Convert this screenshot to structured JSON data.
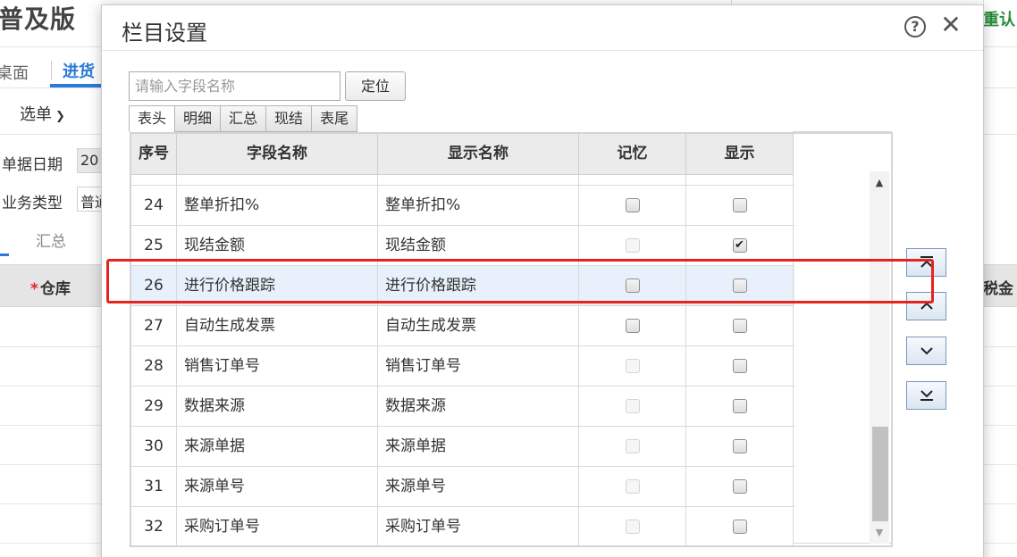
{
  "background": {
    "app_title": "普及版",
    "right_link": "重认",
    "tab_desktop": "桌面",
    "tab_purchase": "进货",
    "select_button": "选单",
    "date_label": "单据日期",
    "date_value": "20",
    "business_type_label": "业务类型",
    "business_type_value": "普通",
    "summary_tab": "汇总",
    "grid_col_warehouse": "仓库",
    "grid_col_required_mark": "*",
    "grid_col_tax": "税金"
  },
  "dialog": {
    "title": "栏目设置",
    "search_placeholder": "请输入字段名称",
    "locate_button": "定位",
    "tabs": [
      {
        "label": "表头",
        "active": true
      },
      {
        "label": "明细",
        "active": false
      },
      {
        "label": "汇总",
        "active": false
      },
      {
        "label": "现结",
        "active": false
      },
      {
        "label": "表尾",
        "active": false
      }
    ],
    "columns": [
      "序号",
      "字段名称",
      "显示名称",
      "记忆",
      "显示"
    ],
    "rows": [
      {
        "no": "24",
        "field": "整单折扣%",
        "display": "整单折扣%",
        "remember": false,
        "remember_enabled": true,
        "show": false,
        "selected": false
      },
      {
        "no": "25",
        "field": "现结金额",
        "display": "现结金额",
        "remember": false,
        "remember_enabled": false,
        "show": true,
        "selected": false
      },
      {
        "no": "26",
        "field": "进行价格跟踪",
        "display": "进行价格跟踪",
        "remember": false,
        "remember_enabled": true,
        "show": false,
        "selected": true
      },
      {
        "no": "27",
        "field": "自动生成发票",
        "display": "自动生成发票",
        "remember": false,
        "remember_enabled": true,
        "show": false,
        "selected": false
      },
      {
        "no": "28",
        "field": "销售订单号",
        "display": "销售订单号",
        "remember": false,
        "remember_enabled": false,
        "show": false,
        "selected": false
      },
      {
        "no": "29",
        "field": "数据来源",
        "display": "数据来源",
        "remember": false,
        "remember_enabled": false,
        "show": false,
        "selected": false
      },
      {
        "no": "30",
        "field": "来源单据",
        "display": "来源单据",
        "remember": false,
        "remember_enabled": false,
        "show": false,
        "selected": false
      },
      {
        "no": "31",
        "field": "来源单号",
        "display": "来源单号",
        "remember": false,
        "remember_enabled": false,
        "show": false,
        "selected": false
      },
      {
        "no": "32",
        "field": "采购订单号",
        "display": "采购订单号",
        "remember": false,
        "remember_enabled": false,
        "show": false,
        "selected": false
      }
    ],
    "move_buttons": [
      "move-top",
      "move-up",
      "move-down",
      "move-bottom"
    ],
    "icons": {
      "help": "question-circle-icon",
      "close": "close-icon"
    },
    "highlight_color": "#e5241f",
    "accent_color": "#2a7ad9"
  }
}
